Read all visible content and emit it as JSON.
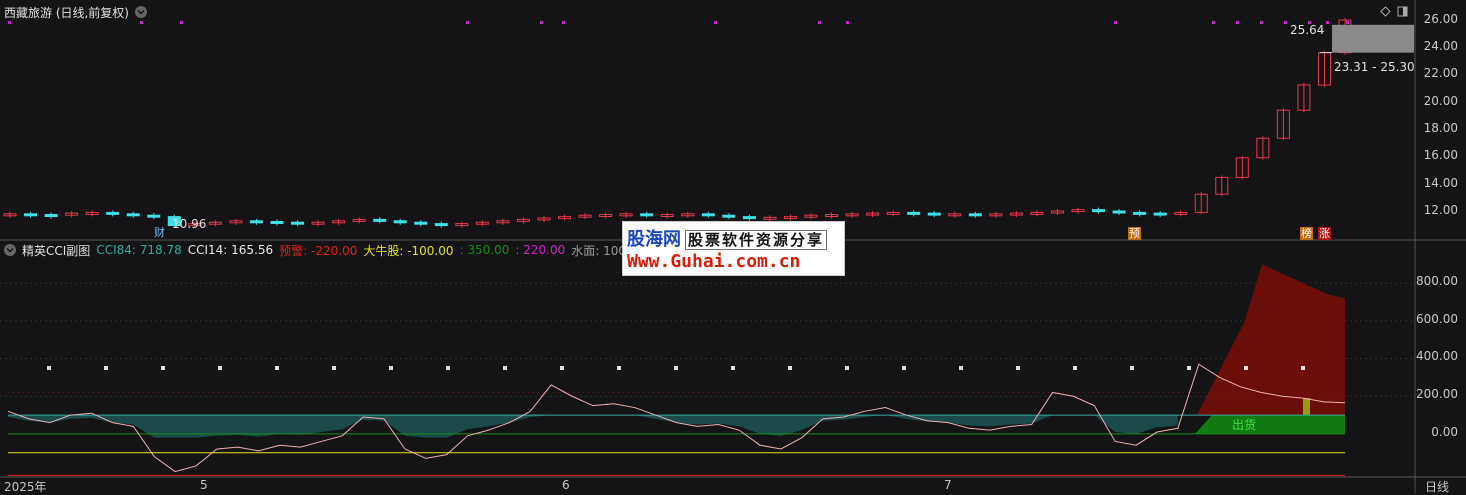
{
  "main": {
    "title": "西藏旅游 (日线,前复权)",
    "price_annotation_low": "10.96",
    "price_annotation_high": "25.64",
    "range_label": "23.31 - 25.30",
    "y_ticks": [
      "26.00",
      "24.00",
      "22.00",
      "20.00",
      "18.00",
      "16.00",
      "14.00",
      "12.00"
    ],
    "markers": {
      "cai": "财",
      "yu": "预",
      "bang": "榜",
      "zhang": "涨"
    }
  },
  "sub": {
    "name": "精英CCI副图",
    "legend": [
      {
        "label": "CCI84: 718.78",
        "color": "#3aa7a0"
      },
      {
        "label": "CCI14: 165.56",
        "color": "#e8e8e8"
      },
      {
        "label": "预警: -220.00",
        "color": "#e02020"
      },
      {
        "label": "大牛股: -100.00",
        "color": "#e8e020"
      },
      {
        "label": ": 350.00",
        "color": "#1a8a1a"
      },
      {
        "label": ": 220.00",
        "color": "#d020d0"
      },
      {
        "label": "水面: 100.00 : 0",
        "color": "#999999"
      }
    ],
    "y_ticks": [
      "800.00",
      "600.00",
      "400.00",
      "200.00",
      "0.00"
    ],
    "chuhuo_label": "出货"
  },
  "x_axis": {
    "labels": [
      "2025年",
      "5",
      "6",
      "7"
    ],
    "period": "日线"
  },
  "ad": {
    "logo": "股海网",
    "slogan": "股票软件资源分享",
    "url": "Www.Guhai.com.cn"
  },
  "colors": {
    "up": "#e8374a",
    "down": "#3ee0e6",
    "bg": "#141416",
    "grid": "#3a3a3a",
    "accent": "#b01010"
  },
  "chart_data": {
    "type": "line",
    "title": "",
    "xlabel": "",
    "ylabel": "",
    "price_ylim": [
      10.5,
      26.5
    ],
    "price_series": [
      11.8,
      11.75,
      11.7,
      11.85,
      11.9,
      11.8,
      11.7,
      11.6,
      10.96,
      11.1,
      11.2,
      11.3,
      11.25,
      11.2,
      11.15,
      11.2,
      11.3,
      11.4,
      11.3,
      11.2,
      11.1,
      11.05,
      11.1,
      11.2,
      11.3,
      11.4,
      11.5,
      11.6,
      11.7,
      11.75,
      11.8,
      11.7,
      11.75,
      11.8,
      11.7,
      11.6,
      11.5,
      11.55,
      11.6,
      11.7,
      11.75,
      11.8,
      11.85,
      11.9,
      11.85,
      11.8,
      11.8,
      11.75,
      11.8,
      11.85,
      11.9,
      12.0,
      12.1,
      12.0,
      11.9,
      11.85,
      11.8,
      11.9,
      13.2,
      14.4,
      15.8,
      17.2,
      19.2,
      21.0,
      23.31,
      25.64
    ],
    "cci14_ylim": [
      -250,
      950
    ],
    "cci14": [
      120,
      80,
      60,
      100,
      110,
      60,
      40,
      -120,
      -200,
      -170,
      -80,
      -70,
      -90,
      -60,
      -70,
      -40,
      -10,
      90,
      80,
      -80,
      -130,
      -110,
      -10,
      20,
      60,
      120,
      260,
      200,
      150,
      160,
      140,
      100,
      60,
      40,
      50,
      20,
      -60,
      -80,
      -20,
      80,
      90,
      120,
      140,
      100,
      70,
      60,
      30,
      20,
      40,
      50,
      220,
      200,
      150,
      -40,
      -60,
      10,
      30,
      370,
      300,
      250,
      220,
      200,
      190,
      170,
      165.56
    ],
    "cci84_fill_top": [
      900,
      860,
      820,
      780,
      740,
      718.78
    ],
    "levels": {
      "warning": -220,
      "bull": -100,
      "water": 100,
      "zero": 0,
      "l350": 350,
      "l220": 220
    }
  }
}
